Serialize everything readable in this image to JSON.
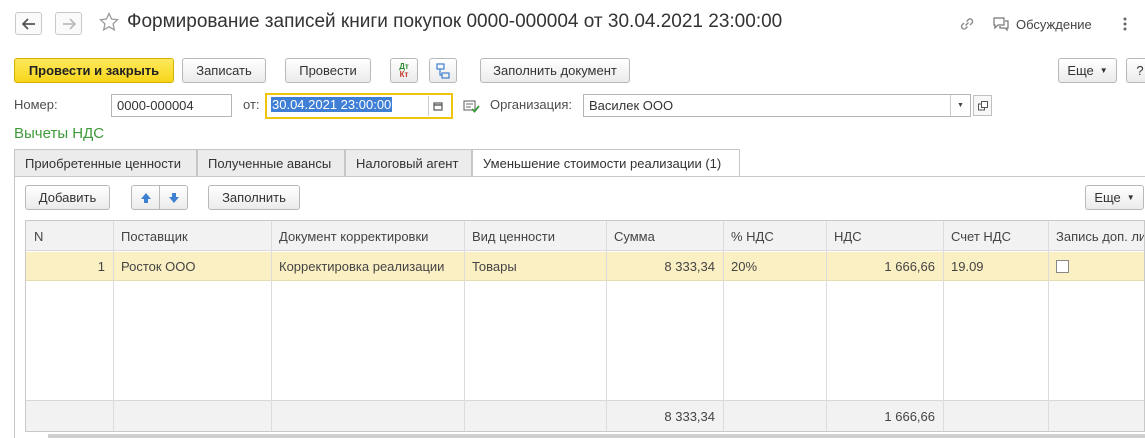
{
  "window": {
    "title": "Формирование записей книги покупок 0000-000004 от 30.04.2021 23:00:00",
    "discussion_label": "Обсуждение",
    "more_icon": "vertical-dots-icon"
  },
  "toolbar": {
    "post_close_label": "Провести и закрыть",
    "save_label": "Записать",
    "post_label": "Провести",
    "dt_icon": "Дт",
    "kt_icon": "Кт",
    "fill_doc_label": "Заполнить документ",
    "more_label": "Еще",
    "help_label": "?"
  },
  "form": {
    "number_label": "Номер:",
    "number_value": "0000-000004",
    "from_label": "от:",
    "date_value": "30.04.2021 23:00:00",
    "org_label": "Организация:",
    "org_value": "Василек ООО"
  },
  "section_title": "Вычеты НДС",
  "tabs": [
    {
      "label": "Приобретенные ценности"
    },
    {
      "label": "Полученные авансы"
    },
    {
      "label": "Налоговый агент"
    },
    {
      "label": "Уменьшение стоимости реализации (1)"
    }
  ],
  "table_toolbar": {
    "add_label": "Добавить",
    "fill_label": "Заполнить",
    "more_label": "Еще"
  },
  "table": {
    "columns": [
      "N",
      "Поставщик",
      "Документ корректировки",
      "Вид ценности",
      "Сумма",
      "% НДС",
      "НДС",
      "Счет НДС",
      "Запись доп. листа"
    ],
    "rows": [
      [
        "1",
        "Росток ООО",
        "Корректировка реализации",
        "Товары",
        "8 333,34",
        "20%",
        "1 666,66",
        "19.09",
        ""
      ]
    ],
    "totals": {
      "sum": "8 333,34",
      "vat": "1 666,66"
    }
  },
  "colors": {
    "accent_yellow": "#f7d51a",
    "selected_row": "#fbf0c4",
    "section_title_green": "#3f9a3a",
    "arrow_blue": "#3d7fd1"
  }
}
